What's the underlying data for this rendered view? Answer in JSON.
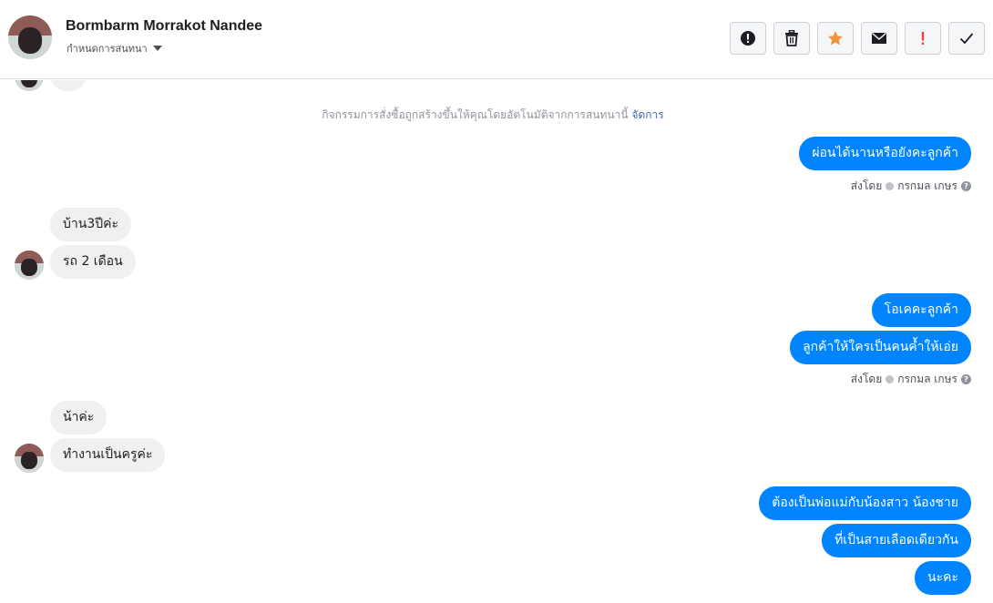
{
  "header": {
    "name": "Bormbarm Morrakot Nandee",
    "assign_label": "กำหนดการสนทนา",
    "tools": [
      {
        "icon": "exclamation-circle-icon"
      },
      {
        "icon": "trash-icon"
      },
      {
        "icon": "star-icon",
        "color": "#f7923b"
      },
      {
        "icon": "envelope-icon"
      },
      {
        "icon": "flag-exclamation-icon",
        "color": "#fa3e3e"
      },
      {
        "icon": "check-icon"
      }
    ]
  },
  "thread": {
    "notice_text": "กิจกรรมการสั่งซื้อถูกสร้างขึ้นให้คุณโดยอัตโนมัติจากการสนทนานี้",
    "notice_link": "จัดการ",
    "messages": [
      {
        "dir": "out",
        "text": "ผ่อนได้นานหรือยังคะลูกค้า"
      },
      {
        "sent_by": "ส่งโดย",
        "sender": "กรกมล เกษร"
      },
      {
        "dir": "in",
        "text": "บ้าน3ปีค่ะ"
      },
      {
        "dir": "in",
        "text": "รถ 2 เดือน"
      },
      {
        "dir": "out",
        "text": "โอเคคะลูกค้า"
      },
      {
        "dir": "out",
        "text": "ลูกค้าให้ใครเป็นคนค้ำให้เอ่ย"
      },
      {
        "sent_by": "ส่งโดย",
        "sender": "กรกมล เกษร"
      },
      {
        "dir": "in",
        "text": "น้าค่ะ"
      },
      {
        "dir": "in",
        "text": "ทำงานเป็นครูค่ะ"
      },
      {
        "dir": "out",
        "text": "ต้องเป็นพ่อแม่กับน้องสาว น้องชาย"
      },
      {
        "dir": "out",
        "text": "ที่เป็นสายเลือดเดียวกัน"
      },
      {
        "dir": "out",
        "text": "นะคะ"
      }
    ]
  },
  "colors": {
    "outgoing": "#0084ff",
    "incoming": "#f1f0f0",
    "link": "#4267b2"
  }
}
